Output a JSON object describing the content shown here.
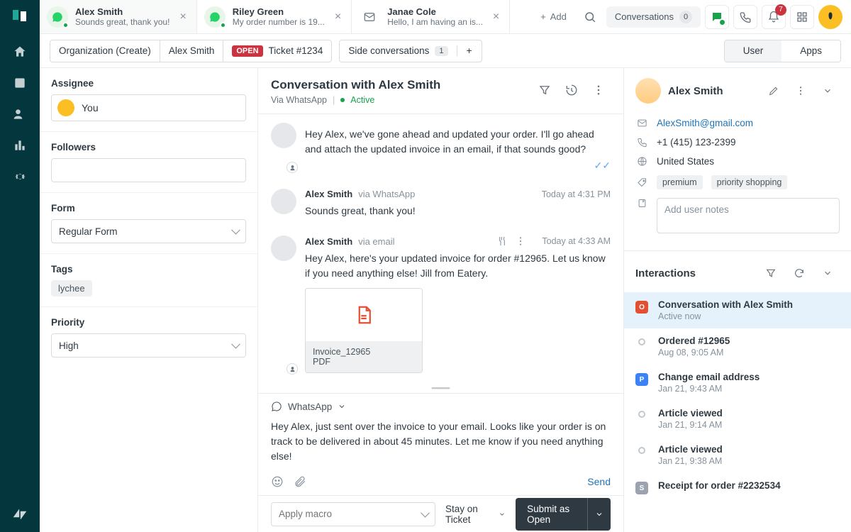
{
  "topbar": {
    "tabs": [
      {
        "channel": "whatsapp",
        "name": "Alex Smith",
        "sub": "Sounds great, thank you!"
      },
      {
        "channel": "whatsapp",
        "name": "Riley Green",
        "sub": "My order number is 19..."
      },
      {
        "channel": "email",
        "name": "Janae Cole",
        "sub": "Hello, I am having an is..."
      }
    ],
    "add_label": "Add",
    "conversations_label": "Conversations",
    "conversations_count": "0",
    "notif_count": "7"
  },
  "crumbs": {
    "org": "Organization (Create)",
    "customer": "Alex Smith",
    "status": "OPEN",
    "ticket": "Ticket #1234",
    "side_label": "Side conversations",
    "side_count": "1",
    "right_tabs": {
      "user": "User",
      "apps": "Apps"
    }
  },
  "left": {
    "assignee_label": "Assignee",
    "assignee_value": "You",
    "followers_label": "Followers",
    "form_label": "Form",
    "form_value": "Regular Form",
    "tags_label": "Tags",
    "tags": [
      "lychee"
    ],
    "priority_label": "Priority",
    "priority_value": "High"
  },
  "conv": {
    "title": "Conversation with Alex Smith",
    "via": "Via WhatsApp",
    "state": "Active",
    "messages": [
      {
        "author": "",
        "via": "",
        "ts": "",
        "text": "Hey Alex, we've gone ahead and updated your order. I'll go ahead and attach the updated invoice in an email, if that sounds good?",
        "sent": true,
        "avatar": "agent"
      },
      {
        "author": "Alex Smith",
        "via": "via WhatsApp",
        "ts": "Today at 4:31 PM",
        "text": "Sounds great, thank you!",
        "avatar": "cust"
      },
      {
        "author": "Alex Smith",
        "via": "via email",
        "ts": "Today at 4:33 AM",
        "text": "Hey Alex, here's your updated invoice for order #12965. Let us know if you need anything else! Jill from Eatery.",
        "avatar": "agent",
        "attach": {
          "name": "Invoice_12965",
          "type": "PDF"
        }
      }
    ]
  },
  "composer": {
    "channel": "WhatsApp",
    "draft": "Hey Alex, just sent over the invoice to your email. Looks like your order is on track to be delivered in about 45 minutes. Let me know if you need anything else!",
    "send": "Send"
  },
  "footer": {
    "macro_placeholder": "Apply macro",
    "stay": "Stay on Ticket",
    "submit": "Submit as Open"
  },
  "user": {
    "name": "Alex Smith",
    "email": "AlexSmith@gmail.com",
    "phone": "+1 (415) 123-2399",
    "location": "United States",
    "tags": [
      "premium",
      "priority shopping"
    ],
    "notes_placeholder": "Add user notes"
  },
  "interactions": {
    "title": "Interactions",
    "items": [
      {
        "badge": "O",
        "title": "Conversation with Alex Smith",
        "sub": "Active now",
        "active": true
      },
      {
        "badge": "",
        "title": "Ordered #12965",
        "sub": "Aug 08, 9:05 AM"
      },
      {
        "badge": "P",
        "title": "Change email address",
        "sub": "Jan 21, 9:43 AM"
      },
      {
        "badge": "",
        "title": "Article viewed",
        "sub": "Jan 21, 9:14 AM"
      },
      {
        "badge": "",
        "title": "Article viewed",
        "sub": "Jan 21, 9:38 AM"
      },
      {
        "badge": "S",
        "title": "Receipt for order #2232534",
        "sub": ""
      }
    ]
  }
}
